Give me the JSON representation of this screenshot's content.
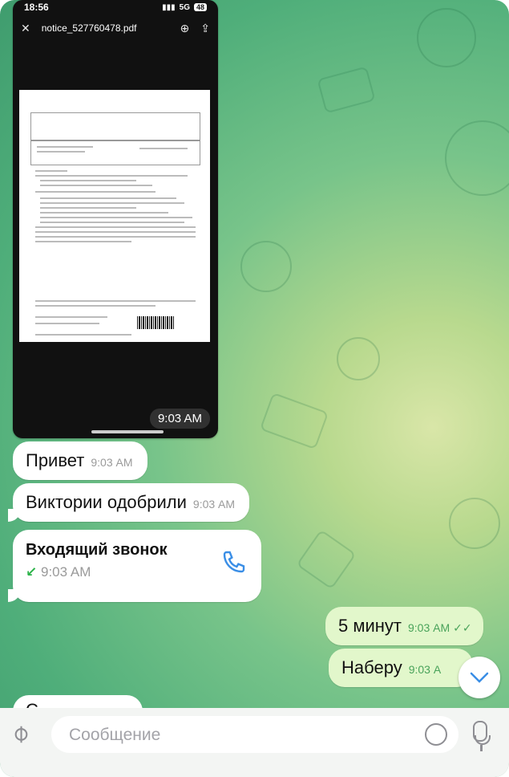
{
  "embedded_screenshot": {
    "status_time": "18:56",
    "network": "5G",
    "battery": "48",
    "file_name": "notice_527760478.pdf",
    "time": "9:03 AM"
  },
  "messages": [
    {
      "text": "Привет",
      "time": "9:03 AM"
    },
    {
      "text": "Виктории одобрили",
      "time": "9:03 AM"
    }
  ],
  "call": {
    "title": "Входящий звонок",
    "time": "9:03 AM"
  },
  "outgoing": [
    {
      "text": "5 минут",
      "time": "9:03 AM",
      "status": "✓✓"
    },
    {
      "text": "Наберу",
      "time": "9:03 A"
    }
  ],
  "partial_message": "C",
  "input": {
    "placeholder": "Сообщение"
  },
  "colors": {
    "outgoing_bubble": "#e2f7cb",
    "accent": "#3a8ee6",
    "call_arrow": "#2db34a"
  }
}
